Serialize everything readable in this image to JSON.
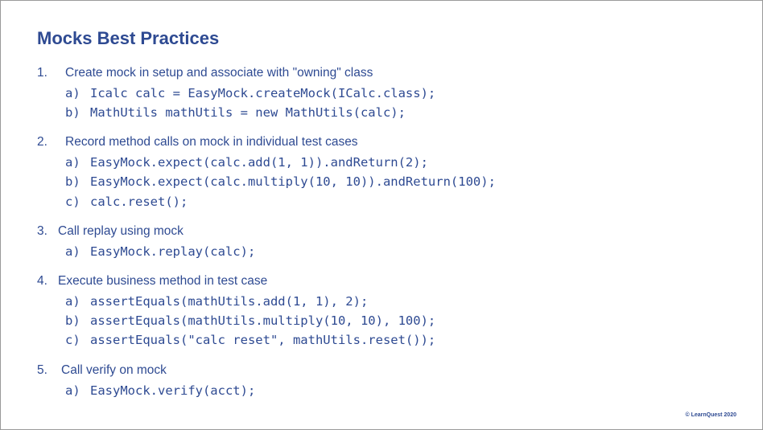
{
  "title": "Mocks Best Practices",
  "items": [
    {
      "number": "1.",
      "text": "Create mock in setup and associate with \"owning\" class",
      "subs": [
        {
          "letter": "a)",
          "code": "Icalc calc = EasyMock.createMock(ICalc.class);"
        },
        {
          "letter": "b)",
          "code": "MathUtils mathUtils = new MathUtils(calc);"
        }
      ]
    },
    {
      "number": "2.",
      "text": "Record method calls on mock in individual test cases",
      "subs": [
        {
          "letter": "a)",
          "code": "EasyMock.expect(calc.add(1, 1)).andReturn(2);"
        },
        {
          "letter": "b)",
          "code": "EasyMock.expect(calc.multiply(10, 10)).andReturn(100);"
        },
        {
          "letter": "c)",
          "code": "calc.reset();"
        }
      ]
    },
    {
      "number": "3.",
      "text": "Call replay using mock",
      "subs": [
        {
          "letter": "a)",
          "code": "EasyMock.replay(calc);"
        }
      ]
    },
    {
      "number": "4.",
      "text": "Execute business method in test case",
      "subs": [
        {
          "letter": "a)",
          "code": "assertEquals(mathUtils.add(1, 1), 2);"
        },
        {
          "letter": "b)",
          "code": "assertEquals(mathUtils.multiply(10, 10), 100);"
        },
        {
          "letter": "c)",
          "code": "assertEquals(\"calc reset\", mathUtils.reset());"
        }
      ]
    },
    {
      "number": "5.",
      "text": "Call verify on mock",
      "subs": [
        {
          "letter": "a)",
          "code": "EasyMock.verify(acct);"
        }
      ]
    }
  ],
  "footer": "© LearnQuest 2020"
}
